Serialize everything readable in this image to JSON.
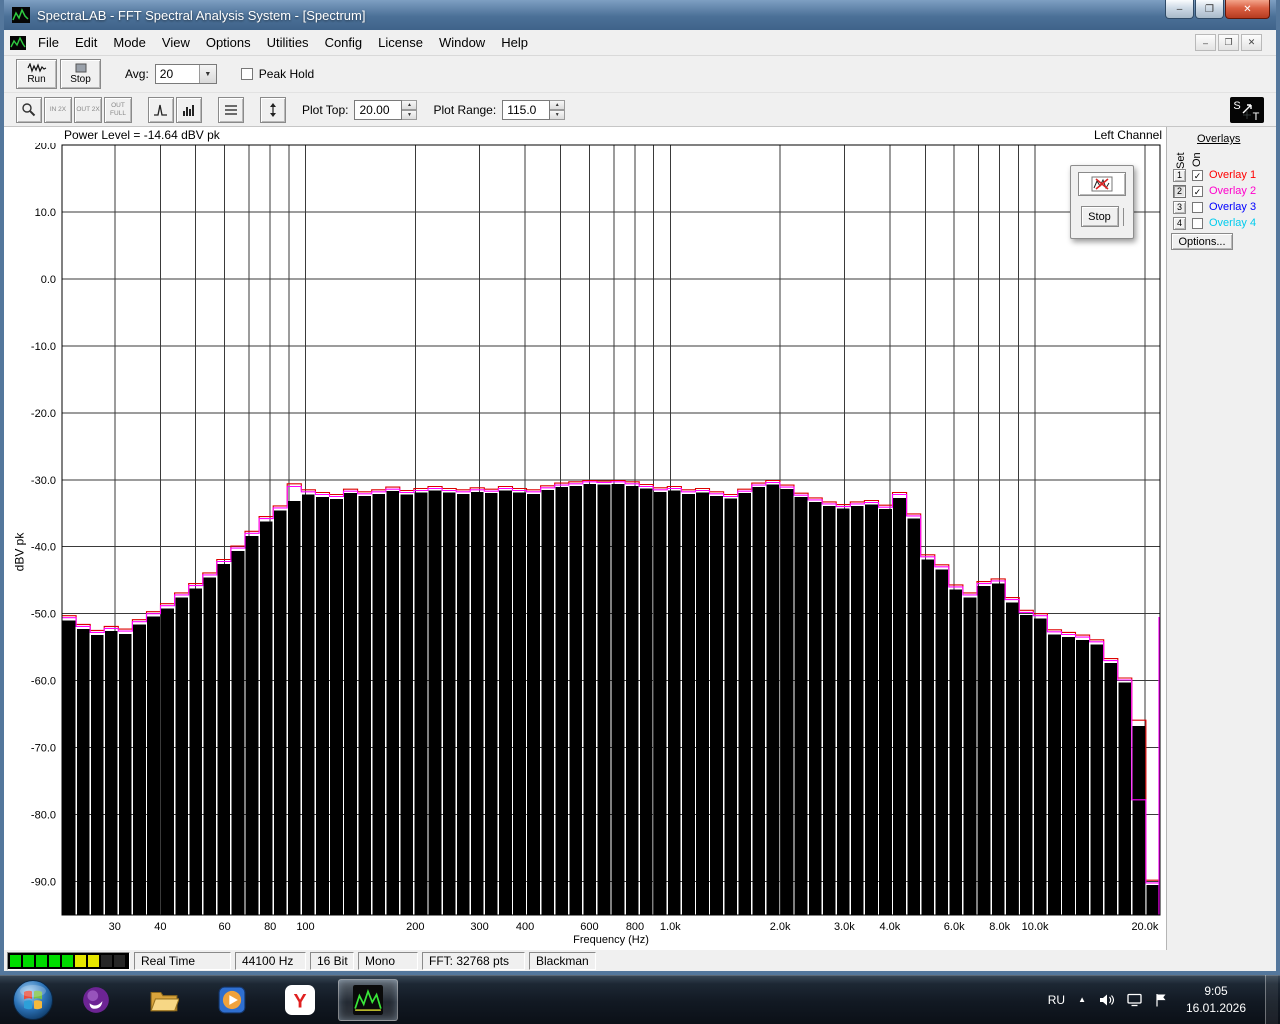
{
  "titlebar": {
    "title": "SpectraLAB - FFT Spectral Analysis System - [Spectrum]"
  },
  "window_controls": {
    "minimize_glyph": "–",
    "restore_glyph": "❐",
    "close_glyph": "✕"
  },
  "mdi_controls": {
    "minimize_glyph": "–",
    "restore_glyph": "❐",
    "close_glyph": "✕"
  },
  "menubar": {
    "items": [
      "File",
      "Edit",
      "Mode",
      "View",
      "Options",
      "Utilities",
      "Config",
      "License",
      "Window",
      "Help"
    ]
  },
  "toolbar_main": {
    "run": "Run",
    "stop": "Stop",
    "avg_label": "Avg:",
    "avg_value": "20",
    "peak_hold": "Peak Hold"
  },
  "toolbar_plot": {
    "zoom_in": "IN 2X",
    "zoom_out": "OUT 2X",
    "zoom_full": "OUT FULL",
    "plot_top_label": "Plot Top:",
    "plot_top_value": "20.00",
    "plot_range_label": "Plot Range:",
    "plot_range_value": "115.0",
    "logo_s": "S",
    "logo_t": "T"
  },
  "chart": {
    "power_level": "Power Level = -14.64 dBV pk",
    "channel": "Left Channel",
    "ylabel": "dBV pk",
    "xlabel": "Frequency (Hz)"
  },
  "chart_data": {
    "type": "bar",
    "title": "Spectrum",
    "x_scale": "log",
    "freq_min": 21.5,
    "freq_max": 22000,
    "y_top": 20,
    "y_bottom": -95,
    "ylabel": "dBV pk",
    "xlabel": "Frequency (Hz)",
    "grid": true,
    "y_ticks": [
      20,
      10,
      0,
      -10,
      -20,
      -30,
      -40,
      -50,
      -60,
      -70,
      -80,
      -90
    ],
    "x_ticks": [
      {
        "f": 30,
        "label": "30"
      },
      {
        "f": 40,
        "label": "40"
      },
      {
        "f": 60,
        "label": "60"
      },
      {
        "f": 80,
        "label": "80"
      },
      {
        "f": 100,
        "label": "100"
      },
      {
        "f": 200,
        "label": "200"
      },
      {
        "f": 300,
        "label": "300"
      },
      {
        "f": 400,
        "label": "400"
      },
      {
        "f": 600,
        "label": "600"
      },
      {
        "f": 800,
        "label": "800"
      },
      {
        "f": 1000,
        "label": "1.0k"
      },
      {
        "f": 2000,
        "label": "2.0k"
      },
      {
        "f": 3000,
        "label": "3.0k"
      },
      {
        "f": 4000,
        "label": "4.0k"
      },
      {
        "f": 6000,
        "label": "6.0k"
      },
      {
        "f": 8000,
        "label": "8.0k"
      },
      {
        "f": 10000,
        "label": "10.0k"
      },
      {
        "f": 20000,
        "label": "20.0k"
      }
    ],
    "bar_color": "#000000",
    "grid_color": "#3a3a3a",
    "bars_db": [
      -51.0,
      -52.3,
      -53.2,
      -52.6,
      -53.0,
      -51.6,
      -50.4,
      -49.2,
      -47.6,
      -46.2,
      -44.6,
      -42.6,
      -40.6,
      -38.4,
      -36.2,
      -34.6,
      -33.2,
      -32.2,
      -32.6,
      -32.9,
      -32.0,
      -32.4,
      -32.1,
      -31.7,
      -32.2,
      -31.9,
      -31.6,
      -31.9,
      -32.1,
      -31.8,
      -32.0,
      -31.6,
      -31.9,
      -32.1,
      -31.5,
      -31.1,
      -30.9,
      -30.6,
      -30.7,
      -30.6,
      -30.9,
      -31.3,
      -31.8,
      -31.6,
      -32.1,
      -31.9,
      -32.4,
      -32.8,
      -32.0,
      -31.1,
      -30.7,
      -31.4,
      -32.6,
      -33.3,
      -33.9,
      -34.3,
      -33.9,
      -33.7,
      -34.4,
      -32.7,
      -35.8,
      -41.9,
      -43.4,
      -46.4,
      -47.6,
      -45.9,
      -45.5,
      -48.3,
      -50.2,
      -50.7,
      -53.1,
      -53.5,
      -53.9,
      -54.6,
      -57.4,
      -60.3,
      -66.8,
      -90.5
    ],
    "overlays": [
      {
        "name": "Overlay 1",
        "color": "#dd0000",
        "values": [
          -50.3,
          -51.6,
          -52.5,
          -51.9,
          -52.3,
          -50.9,
          -49.7,
          -48.5,
          -46.9,
          -45.5,
          -43.9,
          -41.9,
          -39.9,
          -37.7,
          -35.5,
          -33.9,
          -30.6,
          -31.5,
          -31.9,
          -32.2,
          -31.4,
          -31.8,
          -31.5,
          -31.1,
          -31.6,
          -31.3,
          -31.0,
          -31.3,
          -31.5,
          -31.2,
          -31.4,
          -31.0,
          -31.3,
          -31.5,
          -30.9,
          -30.5,
          -30.3,
          -30.1,
          -30.2,
          -30.1,
          -30.3,
          -30.7,
          -31.2,
          -31.0,
          -31.5,
          -31.3,
          -31.8,
          -32.2,
          -31.4,
          -30.5,
          -30.1,
          -30.8,
          -32.0,
          -32.7,
          -33.3,
          -33.7,
          -33.3,
          -33.1,
          -33.8,
          -31.9,
          -35.1,
          -41.2,
          -42.7,
          -45.7,
          -46.9,
          -45.2,
          -44.8,
          -47.6,
          -49.5,
          -50.0,
          -52.4,
          -52.8,
          -53.2,
          -53.9,
          -56.7,
          -59.6,
          -65.9,
          -89.8
        ]
      },
      {
        "name": "Overlay 2",
        "color": "#ff00ff",
        "values": [
          -50.6,
          -51.9,
          -52.8,
          -52.2,
          -52.6,
          -51.2,
          -50.0,
          -48.8,
          -47.2,
          -45.8,
          -44.2,
          -42.2,
          -40.2,
          -38.0,
          -35.8,
          -34.2,
          -31.0,
          -31.8,
          -32.2,
          -32.5,
          -31.7,
          -32.1,
          -31.8,
          -31.4,
          -31.9,
          -31.6,
          -31.3,
          -31.6,
          -31.8,
          -31.5,
          -31.7,
          -31.3,
          -31.6,
          -31.8,
          -31.2,
          -30.8,
          -30.6,
          -30.3,
          -30.4,
          -30.3,
          -30.6,
          -31.0,
          -31.5,
          -31.3,
          -31.8,
          -31.6,
          -32.1,
          -32.5,
          -31.7,
          -30.8,
          -30.4,
          -31.1,
          -32.3,
          -33.0,
          -33.6,
          -34.0,
          -33.6,
          -33.4,
          -34.1,
          -32.2,
          -35.4,
          -41.5,
          -43.0,
          -46.0,
          -47.2,
          -45.5,
          -45.1,
          -47.9,
          -49.8,
          -50.3,
          -52.7,
          -53.1,
          -53.5,
          -54.2,
          -57.0,
          -59.9,
          -77.8,
          -90.2
        ]
      }
    ],
    "right_edge_marker": {
      "color": "#ff00ff",
      "top_db": -50.5
    }
  },
  "overlays_panel": {
    "title": "Overlays",
    "col_set": "Set",
    "col_on": "On",
    "check_glyph": "✓",
    "rows": [
      {
        "num": "1",
        "label": "Overlay 1",
        "color": "#ff0000",
        "checked": true,
        "set_pressed": false
      },
      {
        "num": "2",
        "label": "Overlay 2",
        "color": "#ff00cc",
        "checked": true,
        "set_pressed": true
      },
      {
        "num": "3",
        "label": "Overlay 3",
        "color": "#0000ff",
        "checked": false,
        "set_pressed": false
      },
      {
        "num": "4",
        "label": "Overlay 4",
        "color": "#00ccee",
        "checked": false,
        "set_pressed": false
      }
    ],
    "options": "Options..."
  },
  "floating_toolbar": {
    "stop": "Stop"
  },
  "statusbar": {
    "meter_segments": [
      "green",
      "green",
      "green",
      "green",
      "green",
      "yellow",
      "yellow",
      "off",
      "off"
    ],
    "meter_colors": {
      "green": "#00dc00",
      "yellow": "#e6e600",
      "off": "#262626"
    },
    "panels": [
      "Real Time",
      "44100 Hz",
      "16 Bit",
      "Mono",
      "FFT: 32768 pts",
      "Blackman"
    ]
  },
  "taskbar": {
    "language": "RU",
    "hidden_icons_glyph": "▲",
    "time": "9:05",
    "date": "16.01.2026",
    "yandex_letter": "Y"
  },
  "icon_names": [
    "spectralab-app-icon",
    "zoom-icon",
    "zoom-in-2x",
    "zoom-out-2x",
    "zoom-out-full",
    "peak-curve-icon",
    "spectrum-bars-icon",
    "notes-list-icon",
    "vertical-scale-icon",
    "run-waveform-icon",
    "stop-block-icon",
    "plot-delete-icon",
    "sound-technology-logo",
    "start-orb",
    "messenger-icon",
    "explorer-folder-icon",
    "media-player-icon",
    "yandex-browser-icon",
    "hidden-icons-arrow",
    "volume-icon",
    "display-icon",
    "flag-icon"
  ]
}
